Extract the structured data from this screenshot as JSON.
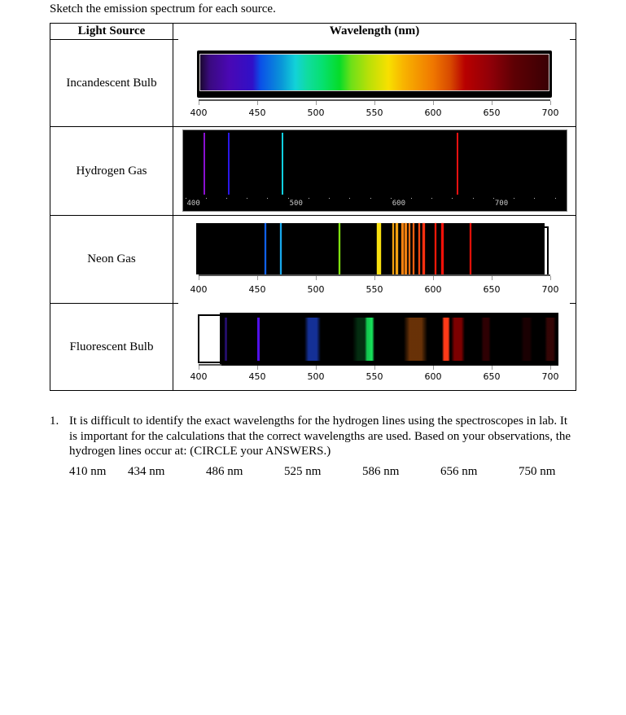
{
  "instructions": "Sketch the emission spectrum for each source.",
  "table": {
    "headers": {
      "source": "Light Source",
      "wavelength": "Wavelength (nm)"
    },
    "rows": [
      {
        "source": "Incandescent Bulb",
        "type": "continuous"
      },
      {
        "source": "Hydrogen Gas",
        "type": "emission-lines"
      },
      {
        "source": "Neon Gas",
        "type": "emission-lines"
      },
      {
        "source": "Fluorescent Bulb",
        "type": "band-emission"
      }
    ]
  },
  "axis": {
    "ticks": [
      "400",
      "450",
      "500",
      "550",
      "600",
      "650",
      "700"
    ],
    "range_nm": [
      400,
      700
    ]
  },
  "hydrogen_axis": {
    "labels": [
      "400",
      "500",
      "600",
      "700"
    ],
    "range_nm": [
      390,
      765
    ]
  },
  "chart_data": [
    {
      "type": "continuous-spectrum",
      "title": "Incandescent Bulb",
      "xlabel": "Wavelength (nm)",
      "xlim": [
        400,
        700
      ],
      "color_stops": [
        {
          "nm": 400,
          "color": "#1a0830"
        },
        {
          "nm": 408,
          "color": "#3a0a80"
        },
        {
          "nm": 425,
          "color": "#4a08b4"
        },
        {
          "nm": 445,
          "color": "#3010c8"
        },
        {
          "nm": 452,
          "color": "#0a50e8"
        },
        {
          "nm": 470,
          "color": "#0a96d8"
        },
        {
          "nm": 482,
          "color": "#12d2d8"
        },
        {
          "nm": 492,
          "color": "#10dca0"
        },
        {
          "nm": 505,
          "color": "#06e070"
        },
        {
          "nm": 520,
          "color": "#06dc28"
        },
        {
          "nm": 530,
          "color": "#6ee018"
        },
        {
          "nm": 545,
          "color": "#b8e008"
        },
        {
          "nm": 562,
          "color": "#f8e000"
        },
        {
          "nm": 575,
          "color": "#f8b400"
        },
        {
          "nm": 600,
          "color": "#f07800"
        },
        {
          "nm": 615,
          "color": "#d84a00"
        },
        {
          "nm": 628,
          "color": "#b80000"
        },
        {
          "nm": 650,
          "color": "#900008"
        },
        {
          "nm": 670,
          "color": "#5e0004"
        },
        {
          "nm": 700,
          "color": "#3a0004"
        }
      ]
    },
    {
      "type": "line-spectrum",
      "title": "Hydrogen Gas",
      "xlim": [
        390,
        765
      ],
      "lines": [
        {
          "nm": 410,
          "color": "#8a10d0"
        },
        {
          "nm": 434,
          "color": "#2a18e8"
        },
        {
          "nm": 486,
          "color": "#10d0e0"
        },
        {
          "nm": 656,
          "color": "#f01010"
        }
      ]
    },
    {
      "type": "line-spectrum",
      "title": "Neon Gas",
      "xlim": [
        400,
        700
      ],
      "lines": [
        {
          "nm": 457,
          "color": "#1060e8",
          "width": 2.5
        },
        {
          "nm": 470,
          "color": "#18a8ec",
          "width": 2.5
        },
        {
          "nm": 520,
          "color": "#80e010",
          "width": 2.5
        },
        {
          "nm": 554,
          "color": "#f8e010",
          "width": 5
        },
        {
          "nm": 566,
          "color": "#f0a010",
          "width": 2.5
        },
        {
          "nm": 569,
          "color": "#f0a010",
          "width": 2.5
        },
        {
          "nm": 574,
          "color": "#f08010",
          "width": 3
        },
        {
          "nm": 577,
          "color": "#f08010",
          "width": 3
        },
        {
          "nm": 580,
          "color": "#f07010",
          "width": 2
        },
        {
          "nm": 583,
          "color": "#f06010",
          "width": 2
        },
        {
          "nm": 588,
          "color": "#f04810",
          "width": 2
        },
        {
          "nm": 592,
          "color": "#f83010",
          "width": 3
        },
        {
          "nm": 602,
          "color": "#f01808",
          "width": 2.5
        },
        {
          "nm": 608,
          "color": "#f01008",
          "width": 2.5
        },
        {
          "nm": 632,
          "color": "#e01008",
          "width": 2.5
        }
      ]
    },
    {
      "type": "band-spectrum",
      "title": "Fluorescent Bulb",
      "xlim": [
        400,
        700
      ],
      "spectrum_start_nm": 418,
      "spectrum_end_nm": 707,
      "bands": [
        {
          "nm": 423,
          "width_nm": 2,
          "color": "#2a1080",
          "opacity": 0.8
        },
        {
          "nm": 451,
          "width_nm": 2.5,
          "color": "#5010e8",
          "opacity": 1
        },
        {
          "nm": 497,
          "width_nm": 14,
          "color": "#1838b0",
          "opacity": 0.85
        },
        {
          "nm": 546,
          "width_nm": 8,
          "color": "#18f060",
          "opacity": 1
        },
        {
          "nm": 540,
          "width_nm": 18,
          "color": "#0a8030",
          "opacity": 0.35
        },
        {
          "nm": 585,
          "width_nm": 20,
          "color": "#7a3a08",
          "opacity": 0.85
        },
        {
          "nm": 611,
          "width_nm": 7,
          "color": "#ff3a18",
          "opacity": 1
        },
        {
          "nm": 621,
          "width_nm": 12,
          "color": "#8a0000",
          "opacity": 0.9
        },
        {
          "nm": 645,
          "width_nm": 8,
          "color": "#3a0004",
          "opacity": 0.8
        },
        {
          "nm": 680,
          "width_nm": 10,
          "color": "#200002",
          "opacity": 0.8
        },
        {
          "nm": 700,
          "width_nm": 10,
          "color": "#3a0606",
          "opacity": 0.9
        }
      ]
    }
  ],
  "question": {
    "number": "1.",
    "text": "It is difficult to identify the exact wavelengths for the hydrogen lines using the spectroscopes in lab. It is important for the calculations that the correct wavelengths are used. Based on your observations, the hydrogen lines occur at:  (CIRCLE your ANSWERS.)",
    "choices": [
      "410 nm",
      "434 nm",
      "486 nm",
      "525 nm",
      "586 nm",
      "656 nm",
      "750 nm"
    ]
  }
}
